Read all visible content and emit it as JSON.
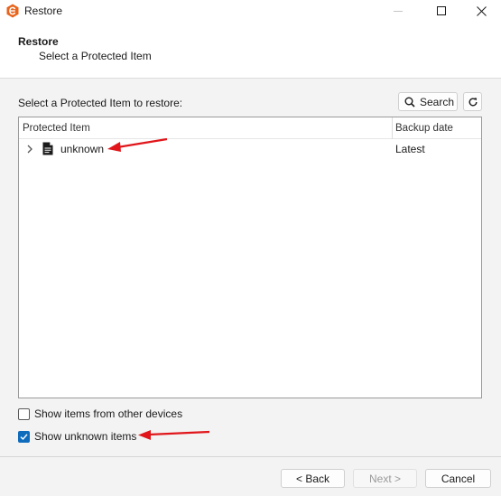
{
  "window": {
    "title": "Restore",
    "app_icon": "app-logo-icon",
    "controls": [
      "minimize-icon",
      "maximize-icon",
      "close-icon"
    ]
  },
  "header": {
    "title": "Restore",
    "subtitle": "Select a Protected Item"
  },
  "main": {
    "prompt": "Select a Protected Item to restore:",
    "search_label": "Search",
    "search_icon": "search-icon",
    "refresh_icon": "refresh-icon",
    "tree": {
      "columns": [
        "Protected Item",
        "Backup date"
      ],
      "rows": [
        {
          "name": "unknown",
          "backup_date": "Latest",
          "icon": "document-icon",
          "expander": "chevron-right-icon"
        }
      ]
    },
    "options": [
      {
        "label": "Show items from other devices",
        "checked": false
      },
      {
        "label": "Show unknown items",
        "checked": true
      }
    ]
  },
  "footer": {
    "back_label": "< Back",
    "next_label": "Next >",
    "cancel_label": "Cancel"
  },
  "colors": {
    "accent": "#0f6cbd",
    "app_icon": "#e8641c",
    "annotation_arrow": "#e0161b"
  }
}
